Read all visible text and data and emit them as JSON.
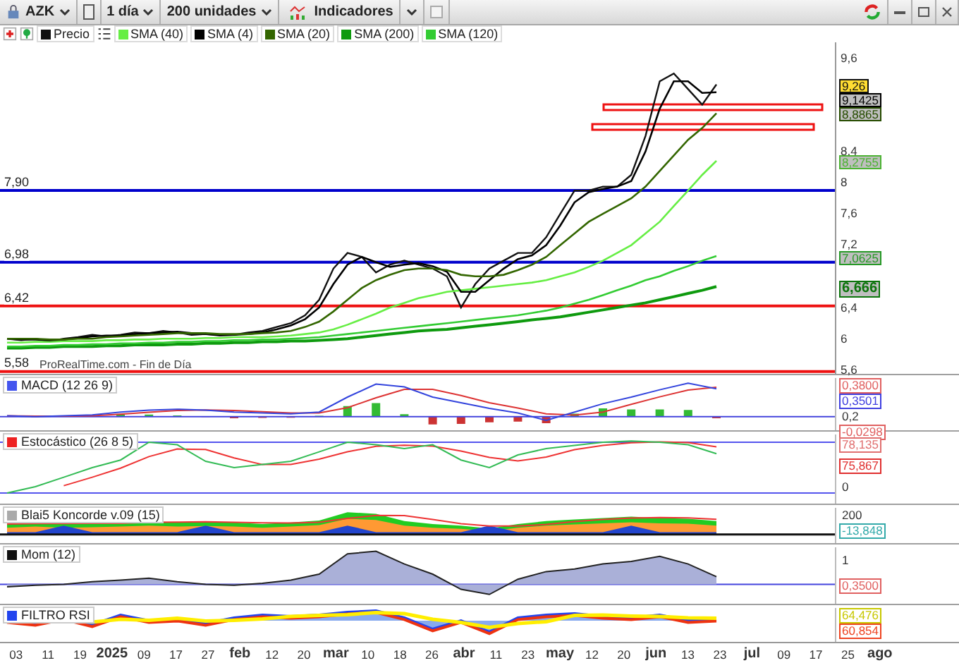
{
  "toolbar": {
    "symbol": "AZK",
    "period": "1 día",
    "units": "200 unidades",
    "indicators": "Indicadores"
  },
  "main_chart": {
    "source": "ProRealTime.com - Fin de Día",
    "value_tags": [
      {
        "label": "9,26",
        "kind": "current"
      },
      {
        "label": "9,1425",
        "kind": "average"
      },
      {
        "label": "8,8865",
        "kind": "average"
      },
      {
        "label": "8,2755",
        "kind": "average"
      },
      {
        "label": "7,0625",
        "kind": "average"
      },
      {
        "label": "6,666",
        "kind": "highlight"
      }
    ],
    "chart_data": {
      "type": "line",
      "ylim": [
        5.55,
        9.8
      ],
      "yticks": [
        {
          "value": 9.6,
          "label": "9,6"
        },
        {
          "value": 8.4,
          "label": "8,4"
        },
        {
          "value": 8,
          "label": "8"
        },
        {
          "value": 7.6,
          "label": "7,6"
        },
        {
          "value": 7.2,
          "label": "7,2"
        },
        {
          "value": 6.4,
          "label": "6,4"
        },
        {
          "value": 6,
          "label": "6"
        },
        {
          "value": 5.6,
          "label": "5,6"
        }
      ],
      "series": [
        {
          "name": "Precio",
          "color": "#111111",
          "values": [
            6.0,
            5.98,
            6.0,
            5.97,
            6.0,
            6.02,
            6.05,
            6.03,
            6.05,
            6.08,
            6.07,
            6.1,
            6.08,
            6.05,
            6.06,
            6.04,
            6.05,
            6.08,
            6.1,
            6.15,
            6.2,
            6.3,
            6.5,
            6.9,
            7.1,
            7.05,
            6.85,
            6.95,
            7.0,
            6.95,
            6.9,
            6.8,
            6.4,
            6.7,
            6.9,
            7.0,
            7.1,
            7.1,
            7.3,
            7.6,
            7.9,
            7.9,
            7.95,
            7.95,
            8.1,
            8.6,
            9.3,
            9.4,
            9.2,
            9.0,
            9.26
          ]
        },
        {
          "name": "SMA (40)",
          "color": "#66ee44",
          "values": [
            5.95,
            5.95,
            5.96,
            5.96,
            5.97,
            5.97,
            5.97,
            5.98,
            5.98,
            5.99,
            5.99,
            6.0,
            6.0,
            6.0,
            6.01,
            6.01,
            6.02,
            6.02,
            6.02,
            6.03,
            6.04,
            6.06,
            6.08,
            6.12,
            6.18,
            6.25,
            6.32,
            6.4,
            6.46,
            6.52,
            6.56,
            6.6,
            6.62,
            6.64,
            6.66,
            6.68,
            6.7,
            6.72,
            6.75,
            6.8,
            6.85,
            6.92,
            7.0,
            7.1,
            7.2,
            7.35,
            7.5,
            7.7,
            7.9,
            8.1,
            8.28
          ]
        },
        {
          "name": "SMA (4)",
          "color": "#000000",
          "values": [
            6.0,
            5.99,
            5.99,
            5.98,
            5.99,
            6.01,
            6.03,
            6.04,
            6.04,
            6.06,
            6.07,
            6.08,
            6.09,
            6.07,
            6.06,
            6.05,
            6.05,
            6.06,
            6.08,
            6.12,
            6.17,
            6.25,
            6.4,
            6.7,
            6.95,
            7.05,
            6.98,
            6.92,
            6.95,
            6.97,
            6.93,
            6.86,
            6.6,
            6.6,
            6.75,
            6.9,
            7.02,
            7.07,
            7.2,
            7.45,
            7.75,
            7.88,
            7.92,
            7.95,
            8.02,
            8.4,
            8.95,
            9.3,
            9.3,
            9.15,
            9.16
          ]
        },
        {
          "name": "SMA (20)",
          "color": "#336600",
          "values": [
            6.0,
            6.0,
            6.0,
            5.99,
            5.99,
            6.0,
            6.0,
            6.02,
            6.03,
            6.04,
            6.05,
            6.06,
            6.07,
            6.07,
            6.07,
            6.06,
            6.06,
            6.06,
            6.07,
            6.08,
            6.1,
            6.15,
            6.22,
            6.35,
            6.5,
            6.65,
            6.75,
            6.82,
            6.88,
            6.9,
            6.9,
            6.88,
            6.82,
            6.8,
            6.8,
            6.82,
            6.88,
            6.95,
            7.05,
            7.2,
            7.35,
            7.5,
            7.6,
            7.7,
            7.8,
            7.95,
            8.15,
            8.35,
            8.55,
            8.7,
            8.89
          ]
        },
        {
          "name": "SMA (200)",
          "color": "#0e9a0e",
          "values": [
            5.88,
            5.88,
            5.89,
            5.89,
            5.9,
            5.9,
            5.9,
            5.91,
            5.91,
            5.92,
            5.92,
            5.92,
            5.93,
            5.93,
            5.94,
            5.94,
            5.95,
            5.95,
            5.96,
            5.96,
            5.97,
            5.97,
            5.98,
            5.99,
            6.0,
            6.02,
            6.04,
            6.06,
            6.08,
            6.1,
            6.11,
            6.12,
            6.14,
            6.16,
            6.18,
            6.2,
            6.22,
            6.24,
            6.26,
            6.28,
            6.31,
            6.34,
            6.37,
            6.4,
            6.43,
            6.46,
            6.5,
            6.54,
            6.58,
            6.62,
            6.67
          ]
        },
        {
          "name": "SMA (120)",
          "color": "#33cc33",
          "values": [
            5.9,
            5.9,
            5.91,
            5.91,
            5.92,
            5.92,
            5.93,
            5.93,
            5.94,
            5.94,
            5.95,
            5.95,
            5.96,
            5.96,
            5.97,
            5.97,
            5.98,
            5.98,
            5.99,
            5.99,
            6.0,
            6.01,
            6.02,
            6.04,
            6.06,
            6.08,
            6.1,
            6.12,
            6.14,
            6.16,
            6.18,
            6.2,
            6.22,
            6.24,
            6.26,
            6.28,
            6.3,
            6.33,
            6.36,
            6.4,
            6.45,
            6.5,
            6.56,
            6.62,
            6.68,
            6.75,
            6.8,
            6.87,
            6.93,
            7.0,
            7.06
          ]
        }
      ],
      "ref_lines": [
        {
          "axis": "y",
          "value": 7.9,
          "label": "7,90",
          "color": "#0000cc"
        },
        {
          "axis": "y",
          "value": 6.98,
          "label": "6,98",
          "color": "#0000cc"
        },
        {
          "axis": "y",
          "value": 6.42,
          "label": "6,42",
          "color": "#ee1111"
        },
        {
          "axis": "y",
          "value": 5.58,
          "label": "5,58",
          "color": "#ee1111"
        }
      ]
    }
  },
  "panels": [
    {
      "kind": "macd",
      "title": "MACD (12 26 9)",
      "color": "#4455ee",
      "axis": [
        {
          "text": "0,3800",
          "color": "#e06060"
        },
        {
          "text": "0,3501",
          "color": "#4040e0"
        },
        {
          "text": "0,2"
        },
        {
          "text": "-0,0298",
          "color": "#e06060"
        }
      ]
    },
    {
      "kind": "stochastic",
      "title": "Estocástico (26 8 5)",
      "color": "#ee2222",
      "axis": [
        {
          "text": "78,135",
          "color": "#e07070"
        },
        {
          "text": "75,867",
          "color": "#e03030"
        },
        {
          "text": "0"
        }
      ]
    },
    {
      "kind": "koncorde",
      "title": "Blai5 Koncorde v.09 (15)",
      "color": "#aaaaaa",
      "axis": [
        {
          "text": "200"
        },
        {
          "text": "-13,848",
          "color": "#33aaaa"
        }
      ]
    },
    {
      "kind": "momentum",
      "title": "Mom (12)",
      "color": "#111111",
      "axis": [
        {
          "text": "1"
        },
        {
          "text": "0,3500",
          "color": "#e06060"
        }
      ]
    },
    {
      "kind": "rsi",
      "title": "FILTRO RSI",
      "color": "#2244ee",
      "axis": [
        {
          "text": "64,476",
          "color": "#c8c800"
        },
        {
          "text": "60,854",
          "color": "#ee4422"
        }
      ]
    }
  ],
  "x_axis": [
    {
      "label": "03",
      "kind": "day"
    },
    {
      "label": "11",
      "kind": "day"
    },
    {
      "label": "19",
      "kind": "day"
    },
    {
      "label": "2025",
      "kind": "year"
    },
    {
      "label": "09",
      "kind": "day"
    },
    {
      "label": "17",
      "kind": "day"
    },
    {
      "label": "27",
      "kind": "day"
    },
    {
      "label": "feb",
      "kind": "month"
    },
    {
      "label": "12",
      "kind": "day"
    },
    {
      "label": "20",
      "kind": "day"
    },
    {
      "label": "mar",
      "kind": "month"
    },
    {
      "label": "10",
      "kind": "day"
    },
    {
      "label": "18",
      "kind": "day"
    },
    {
      "label": "26",
      "kind": "day"
    },
    {
      "label": "abr",
      "kind": "month"
    },
    {
      "label": "11",
      "kind": "day"
    },
    {
      "label": "23",
      "kind": "day"
    },
    {
      "label": "may",
      "kind": "month"
    },
    {
      "label": "12",
      "kind": "day"
    },
    {
      "label": "20",
      "kind": "day"
    },
    {
      "label": "jun",
      "kind": "month"
    },
    {
      "label": "13",
      "kind": "day"
    },
    {
      "label": "23",
      "kind": "day"
    },
    {
      "label": "jul",
      "kind": "month"
    },
    {
      "label": "09",
      "kind": "day"
    },
    {
      "label": "17",
      "kind": "day"
    },
    {
      "label": "25",
      "kind": "day"
    },
    {
      "label": "ago",
      "kind": "month"
    }
  ]
}
